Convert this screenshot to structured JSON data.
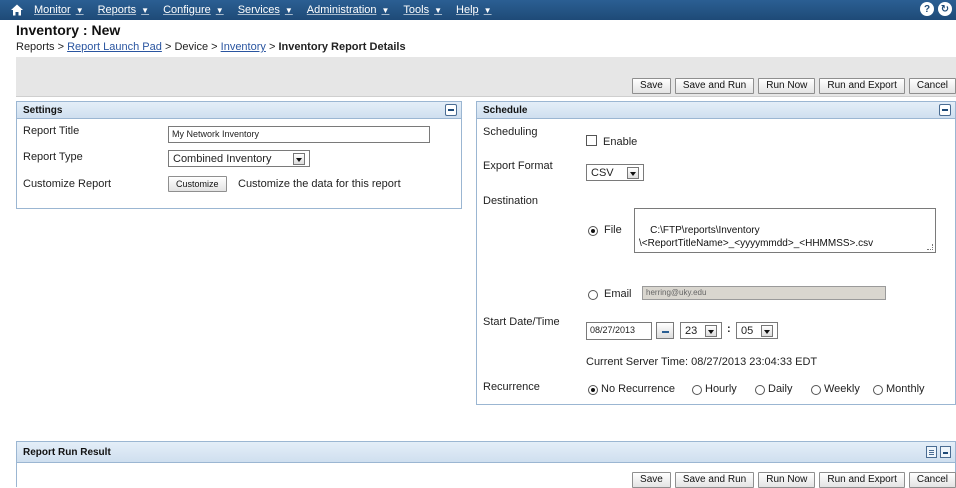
{
  "nav": {
    "items": [
      "Monitor",
      "Reports",
      "Configure",
      "Services",
      "Administration",
      "Tools",
      "Help"
    ],
    "right_icons": [
      "help-icon",
      "refresh-icon"
    ]
  },
  "page": {
    "title": "Inventory : New",
    "breadcrumb": {
      "reports": "Reports",
      "sep1": ">",
      "report_launch_pad": "Report Launch Pad",
      "sep2": ">",
      "device": "Device",
      "sep3": ">",
      "inventory": "Inventory",
      "sep4": ">",
      "current": "Inventory Report Details"
    }
  },
  "buttons": {
    "save": "Save",
    "save_and_run": "Save and Run",
    "run_now": "Run Now",
    "run_and_export": "Run and Export",
    "cancel": "Cancel"
  },
  "settings": {
    "header": "Settings",
    "report_title_label": "Report Title",
    "report_title_value": "My Network Inventory",
    "report_type_label": "Report Type",
    "report_type_value": "Combined Inventory",
    "customize_label": "Customize Report",
    "customize_button": "Customize",
    "customize_hint": "Customize the data for this report"
  },
  "schedule": {
    "header": "Schedule",
    "scheduling_label": "Scheduling",
    "enable_label": "Enable",
    "enable_checked": false,
    "export_format_label": "Export Format",
    "export_format_value": "CSV",
    "destination_label": "Destination",
    "file_label": "File",
    "file_path": "C:\\FTP\\reports\\Inventory\n\\<ReportTitleName>_<yyyymmdd>_<HHMMSS>.csv",
    "email_label": "Email",
    "email_value": "herring@uky.edu",
    "destination_selected": "File",
    "start_label": "Start Date/Time",
    "start_date": "08/27/2013",
    "start_hour": "23",
    "time_sep": ":",
    "start_minute": "05",
    "server_time": "Current Server Time: 08/27/2013 23:04:33 EDT",
    "recurrence_label": "Recurrence",
    "recurrence_options": [
      "No Recurrence",
      "Hourly",
      "Daily",
      "Weekly",
      "Monthly"
    ],
    "recurrence_selected": "No Recurrence"
  },
  "result": {
    "header": "Report Run Result"
  },
  "colors": {
    "nav_bg": "#1e4a77",
    "panel_border": "#9bb6d2",
    "link": "#2a55a0"
  }
}
